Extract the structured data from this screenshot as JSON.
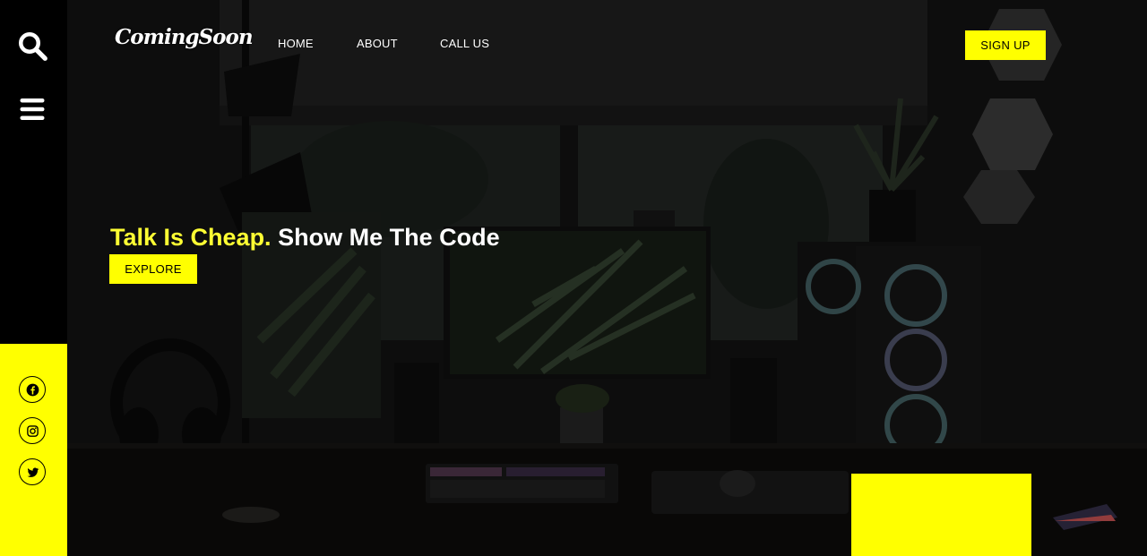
{
  "brand": {
    "logo_text": "ComingSoon"
  },
  "nav": {
    "items": [
      {
        "label": "HOME"
      },
      {
        "label": "ABOUT"
      },
      {
        "label": "CALL US"
      }
    ],
    "signup_label": "SIGN UP"
  },
  "rail": {
    "search_icon": "search-icon",
    "menu_icon": "hamburger-menu-icon",
    "social": [
      {
        "icon": "facebook-icon"
      },
      {
        "icon": "instagram-icon"
      },
      {
        "icon": "twitter-icon"
      }
    ]
  },
  "hero": {
    "headline_highlight": "Talk Is Cheap.",
    "headline_rest": "Show Me The Code",
    "cta_label": "EXPLORE"
  },
  "colors": {
    "accent": "#ffff00",
    "background": "#000000",
    "text": "#ffffff"
  }
}
